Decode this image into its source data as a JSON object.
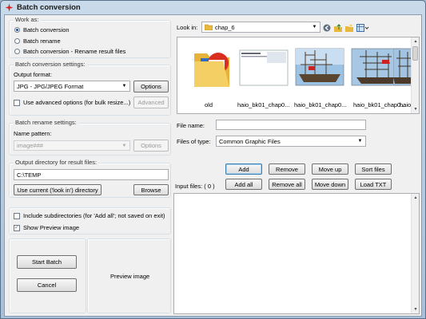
{
  "window": {
    "title": "Batch conversion"
  },
  "work_as": {
    "label": "Work as:",
    "options": [
      {
        "label": "Batch conversion",
        "selected": true
      },
      {
        "label": "Batch rename",
        "selected": false
      },
      {
        "label": "Batch conversion - Rename result files",
        "selected": false
      }
    ]
  },
  "conversion_settings": {
    "label": "Batch conversion settings:",
    "output_format_label": "Output format:",
    "output_format_value": "JPG - JPG/JPEG Format",
    "options_button": "Options",
    "advanced_checkbox_label": "Use advanced options (for bulk resize...)",
    "advanced_checked": false,
    "advanced_button": "Advanced"
  },
  "rename_settings": {
    "label": "Batch rename settings:",
    "name_pattern_label": "Name pattern:",
    "name_pattern_value": "image###",
    "options_button": "Options"
  },
  "output_directory": {
    "label": "Output directory for result files:",
    "value": "C:\\TEMP",
    "use_current_button": "Use current ('look in') directory",
    "browse_button": "Browse"
  },
  "options": {
    "include_subdirs_label": "Include subdirectories (for 'Add all'; not saved on exit)",
    "include_subdirs_checked": false,
    "show_preview_label": "Show Preview image",
    "show_preview_checked": true
  },
  "actions": {
    "start_batch": "Start Batch",
    "cancel": "Cancel",
    "preview_image_label": "Preview image"
  },
  "browser": {
    "look_in_label": "Look in:",
    "look_in_value": "chap_6",
    "thumbnails": [
      {
        "name": "old",
        "kind": "folder"
      },
      {
        "name": "haio_bk01_chap0...",
        "kind": "document"
      },
      {
        "name": "haio_bk01_chap0...",
        "kind": "ship"
      },
      {
        "name": "haio_bk01_chap0...",
        "kind": "ship"
      },
      {
        "name": "haio_bk01_chap0...",
        "kind": "ship"
      }
    ],
    "file_name_label": "File name:",
    "file_name_value": "",
    "files_of_type_label": "Files of type:",
    "files_of_type_value": "Common Graphic Files"
  },
  "list_buttons": {
    "add": "Add",
    "remove": "Remove",
    "move_up": "Move up",
    "sort_files": "Sort files",
    "add_all": "Add all",
    "remove_all": "Remove all",
    "move_down": "Move down",
    "load_txt": "Load TXT"
  },
  "input_files": {
    "label": "Input files: ( 0 )"
  },
  "colors": {
    "title_gradient_top": "#c9daea",
    "title_gradient_bottom": "#a8c0da",
    "panel_bg": "#f0f0f0",
    "default_button_border": "#3c7fb1"
  },
  "icons": [
    "app-icon",
    "folder-icon",
    "back-icon",
    "up-folder-icon",
    "new-folder-icon",
    "view-menu-icon"
  ]
}
